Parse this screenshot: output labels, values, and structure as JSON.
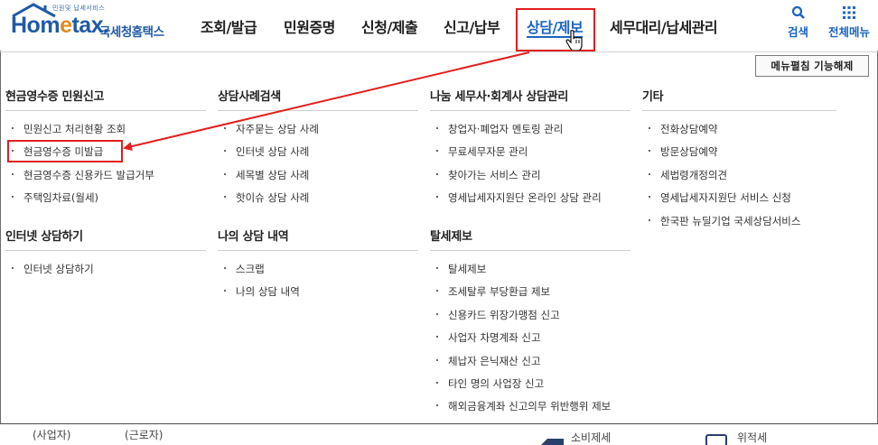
{
  "logo": {
    "tagline": "민원및 납세서비스",
    "brand_part1": "Hom",
    "brand_part2": "e",
    "brand_part3": "tax.",
    "service_name": "국세청홈택스",
    "accent_color": "#1f5aa6",
    "highlight_color": "#e08a1e"
  },
  "nav": {
    "items": [
      {
        "label": "조회/발급"
      },
      {
        "label": "민원증명"
      },
      {
        "label": "신청/제출"
      },
      {
        "label": "신고/납부"
      },
      {
        "label": "상담/제보",
        "active": true
      },
      {
        "label": "세무대리/납세관리"
      }
    ],
    "search_label": "검색",
    "all_menu_label": "전체메뉴",
    "active_color": "#1c64c0"
  },
  "close_button": "메뉴펼침 기능해제",
  "menu": {
    "sections": [
      {
        "title": "현금영수증 민원신고",
        "items": [
          "민원신고 처리현황 조회",
          "현금영수증 미발급",
          "현금영수증 신용카드 발급거부",
          "주택임차료(월세)"
        ]
      },
      {
        "title": "인터넷 상담하기",
        "items": [
          "인터넷 상담하기"
        ]
      },
      {
        "title": "상담사례검색",
        "items": [
          "자주묻는 상담 사례",
          "인터넷 상담 사례",
          "세목별 상담 사례",
          "핫이슈 상담 사례"
        ]
      },
      {
        "title": "나의 상담 내역",
        "items": [
          "스크랩",
          "나의 상담 내역"
        ]
      },
      {
        "title": "나눔 세무사·회계사 상담관리",
        "items": [
          "창업자·폐업자 멘토링 관리",
          "무료세무자문 관리",
          "찾아가는 서비스 관리",
          "영세납세자지원단 온라인 상담 관리"
        ]
      },
      {
        "title": "탈세제보",
        "items": [
          "탈세제보",
          "조세탈루 부당환급 제보",
          "신용카드 위장가맹점 신고",
          "사업자 차명계좌 신고",
          "체납자 은닉재산 신고",
          "타인 명의 사업장 신고",
          "해외금융계좌 신고의무 위반행위 제보"
        ]
      },
      {
        "title": "기타",
        "items": [
          "전화상담예약",
          "방문상담예약",
          "세법령개정의견",
          "영세납세자지원단 서비스 신청",
          "한국판 뉴딜기업 국세상담서비스"
        ]
      }
    ]
  },
  "annotation": {
    "color": "#e21e1e",
    "highlighted_item": "현금영수증 미발급"
  },
  "bottom_strip": {
    "left_text_1": "(사업자)",
    "left_text_2": "(근로자)",
    "right_text_1": "소비제세",
    "right_text_2": "위적세"
  }
}
